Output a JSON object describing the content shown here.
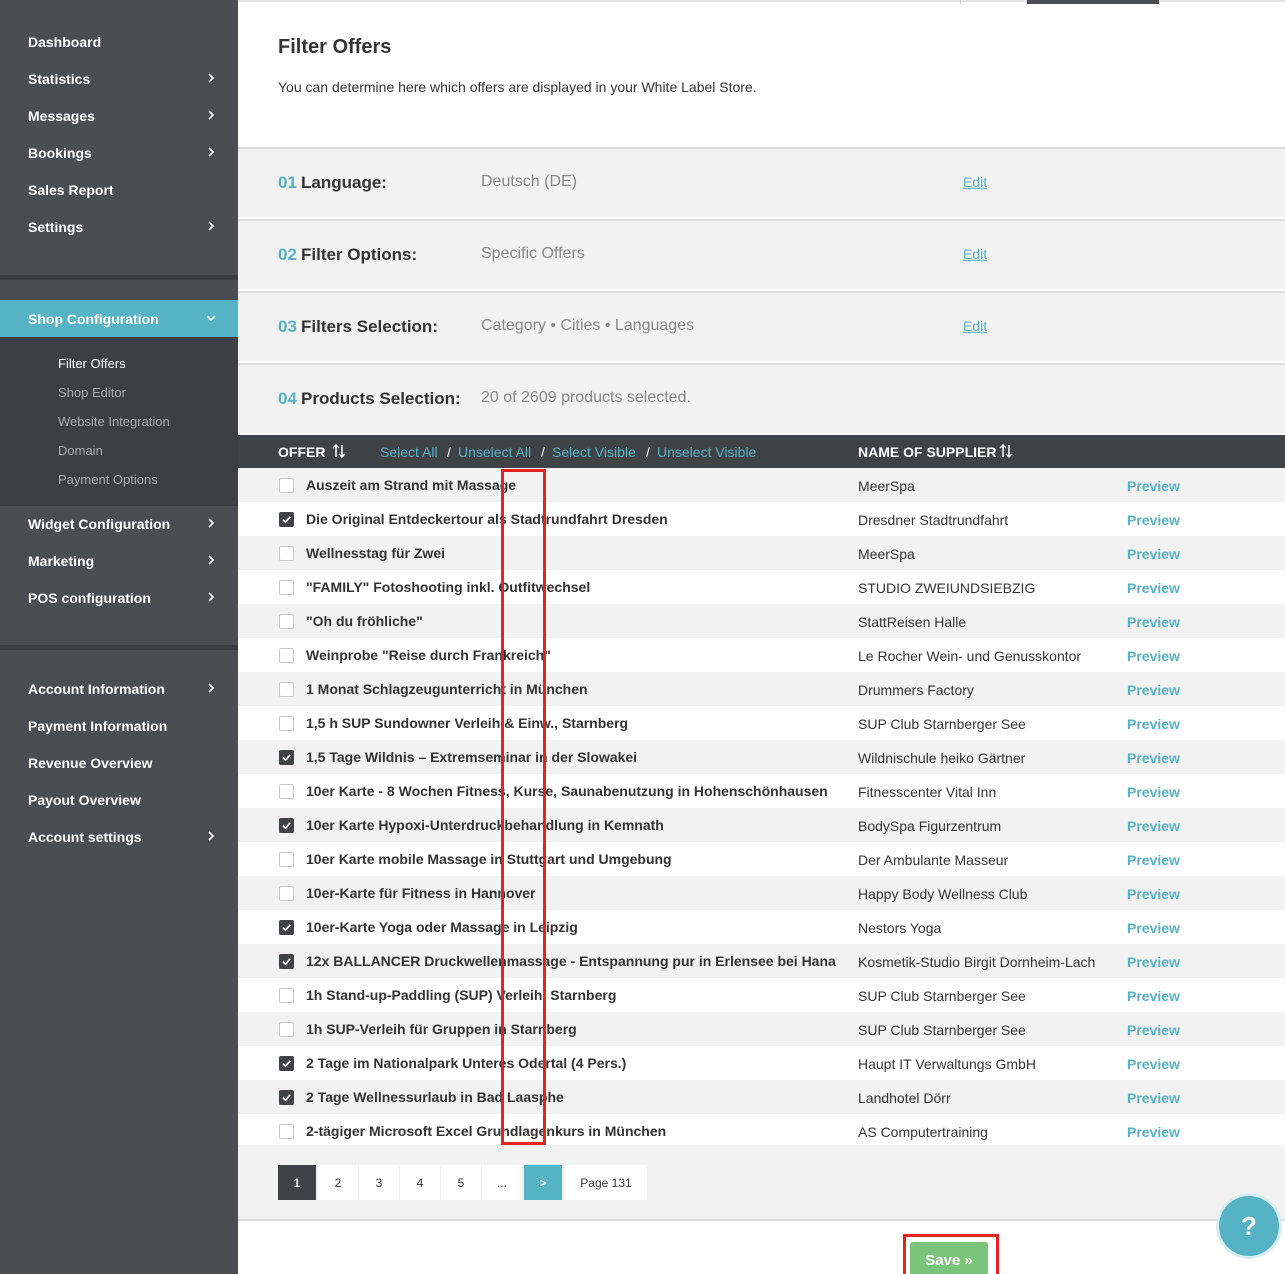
{
  "sidebar": {
    "main_items": [
      {
        "label": "Dashboard",
        "has_children": false
      },
      {
        "label": "Statistics",
        "has_children": true
      },
      {
        "label": "Messages",
        "has_children": true
      },
      {
        "label": "Bookings",
        "has_children": true
      },
      {
        "label": "Sales Report",
        "has_children": false
      },
      {
        "label": "Settings",
        "has_children": true
      }
    ],
    "shop_config": {
      "label": "Shop Configuration",
      "expanded": true
    },
    "sub_items": [
      {
        "label": "Filter Offers",
        "active": true
      },
      {
        "label": "Shop Editor",
        "active": false
      },
      {
        "label": "Website Integration",
        "active": false
      },
      {
        "label": "Domain",
        "active": false
      },
      {
        "label": "Payment Options",
        "active": false
      }
    ],
    "more_items": [
      {
        "label": "Widget Configuration",
        "has_children": true
      },
      {
        "label": "Marketing",
        "has_children": true
      },
      {
        "label": "POS configuration",
        "has_children": true
      }
    ],
    "account_items": [
      {
        "label": "Account Information",
        "has_children": true
      },
      {
        "label": "Payment Information",
        "has_children": false
      },
      {
        "label": "Revenue Overview",
        "has_children": false
      },
      {
        "label": "Payout Overview",
        "has_children": false
      },
      {
        "label": "Account settings",
        "has_children": true
      }
    ]
  },
  "page": {
    "title": "Filter Offers",
    "description": "You can determine here which offers are displayed in your White Label Store."
  },
  "steps": [
    {
      "num": "01",
      "label": "Language:",
      "value": "Deutsch (DE)",
      "edit": "Edit"
    },
    {
      "num": "02",
      "label": "Filter Options:",
      "value": "Specific Offers",
      "edit": "Edit"
    },
    {
      "num": "03",
      "label": "Filters Selection:",
      "value": "Category • Cities • Languages",
      "edit": "Edit"
    },
    {
      "num": "04",
      "label": "Products Selection:",
      "value": "20 of 2609 products selected.",
      "edit": ""
    }
  ],
  "table": {
    "col_offer": "OFFER",
    "select_all": "Select All",
    "unselect_all": "Unselect All",
    "select_visible": "Select Visible",
    "unselect_visible": "Unselect Visible",
    "separator": "/",
    "col_supplier": "NAME OF SUPPLIER",
    "preview_label": "Preview",
    "rows": [
      {
        "offer": "Auszeit am Strand mit Massage",
        "supplier": "MeerSpa",
        "checked": false
      },
      {
        "offer": "Die Original Entdeckertour als Stadtrundfahrt Dresden",
        "supplier": "Dresdner Stadtrundfahrt",
        "checked": true
      },
      {
        "offer": "Wellnesstag für Zwei",
        "supplier": "MeerSpa",
        "checked": false
      },
      {
        "offer": "\"FAMILY\" Fotoshooting inkl. Outfitwechsel",
        "supplier": "STUDIO ZWEIUNDSIEBZIG",
        "checked": false
      },
      {
        "offer": "\"Oh du fröhliche\"",
        "supplier": "StattReisen Halle",
        "checked": false
      },
      {
        "offer": "Weinprobe \"Reise durch Frankreich\"",
        "supplier": "Le Rocher Wein- und Genusskontor",
        "checked": false
      },
      {
        "offer": "1 Monat Schlagzeugunterricht in München",
        "supplier": "Drummers Factory",
        "checked": false
      },
      {
        "offer": "1,5 h SUP Sundowner Verleih & Einw., Starnberg",
        "supplier": "SUP Club Starnberger See",
        "checked": false
      },
      {
        "offer": "1,5 Tage Wildnis – Extremseminar in der Slowakei",
        "supplier": "Wildnischule heiko Gärtner",
        "checked": true
      },
      {
        "offer": "10er Karte - 8 Wochen Fitness, Kurse, Saunabenutzung in Hohenschönhausen",
        "supplier": "Fitnesscenter Vital Inn",
        "checked": false
      },
      {
        "offer": "10er Karte Hypoxi-Unterdruckbehandlung in Kemnath",
        "supplier": "BodySpa Figurzentrum",
        "checked": true
      },
      {
        "offer": "10er Karte mobile Massage in Stuttgart und Umgebung",
        "supplier": "Der Ambulante Masseur",
        "checked": false
      },
      {
        "offer": "10er-Karte für Fitness in Hannover",
        "supplier": "Happy Body Wellness Club",
        "checked": false
      },
      {
        "offer": "10er-Karte Yoga oder Massage in Leipzig",
        "supplier": "Nestors Yoga",
        "checked": true
      },
      {
        "offer": "12x BALLANCER Druckwellenmassage - Entspannung pur in Erlensee bei Hanau",
        "supplier": "Kosmetik-Studio Birgit Dornheim-Lach",
        "checked": true
      },
      {
        "offer": "1h Stand-up-Paddling (SUP) Verleih, Starnberg",
        "supplier": "SUP Club Starnberger See",
        "checked": false
      },
      {
        "offer": "1h SUP-Verleih für Gruppen in Starnberg",
        "supplier": "SUP Club Starnberger See",
        "checked": false
      },
      {
        "offer": "2 Tage im Nationalpark Unteres Odertal (4 Pers.)",
        "supplier": "Haupt IT Verwaltungs GmbH",
        "checked": true
      },
      {
        "offer": "2 Tage Wellnessurlaub in Bad Laasphe",
        "supplier": "Landhotel Dörr",
        "checked": true
      },
      {
        "offer": "2-tägiger Microsoft Excel Grundlagenkurs in München",
        "supplier": "AS Computertraining",
        "checked": false
      }
    ]
  },
  "pagination": {
    "pages": [
      "1",
      "2",
      "3",
      "4",
      "5",
      "..."
    ],
    "current": "1",
    "next": ">",
    "total_label": "Page 131"
  },
  "actions": {
    "save_label": "Save »",
    "help_label": "?"
  },
  "colors": {
    "accent": "#56b3c5",
    "sidebar": "#4a4d52",
    "save": "#7bc47b",
    "highlight": "#e52420"
  }
}
